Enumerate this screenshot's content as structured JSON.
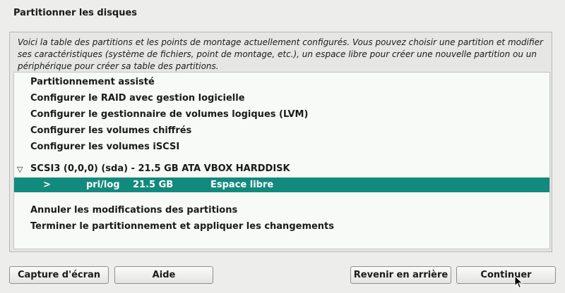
{
  "window": {
    "title": "Partitionner les disques"
  },
  "description": "Voici la table des partitions et les points de montage actuellement configurés. Vous pouvez choisir une partition et modifier ses caractéristiques (système de fichiers, point de montage, etc.), un espace libre pour créer une nouvelle partition ou un périphérique pour créer sa table des partitions.",
  "menu": {
    "guided": "Partitionnement assisté",
    "raid": "Configurer le RAID avec gestion logicielle",
    "lvm": "Configurer le gestionnaire de volumes logiques (LVM)",
    "encrypted": "Configurer les volumes chiffrés",
    "iscsi": "Configurer les volumes iSCSI"
  },
  "disk": {
    "label": "SCSI3 (0,0,0) (sda) - 21.5 GB ATA VBOX HARDDISK",
    "partition": {
      "marker": ">",
      "type": "pri/log",
      "size": "21.5 GB",
      "usage": "Espace libre"
    }
  },
  "actions": {
    "undo": "Annuler les modifications des partitions",
    "finish": "Terminer le partitionnement et appliquer les changements"
  },
  "buttons": {
    "screenshot": "Capture d'écran",
    "help": "Aide",
    "back": "Revenir en arrière",
    "continue": "Continuer"
  },
  "colors": {
    "selection": "#138a7e",
    "background": "#ededeb"
  }
}
